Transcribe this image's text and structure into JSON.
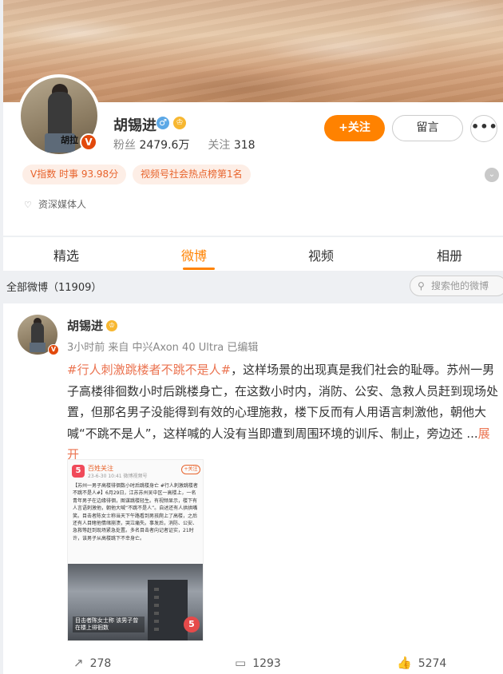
{
  "profile": {
    "name": "胡锡进",
    "avatar_text": "胡拉",
    "verified_badge": "V",
    "gender_icon": "♂",
    "crown_icon": "♔",
    "fans_label": "粉丝",
    "fans_value": "2479.6万",
    "follow_label": "关注",
    "follow_value": "318",
    "follow_button": "+关注",
    "message_button": "留言",
    "more_button": "•••",
    "pill_vindex": "V指数 时事 93.98分",
    "pill_rank": "视频号社会热点榜第1名",
    "expand_icon": "⌄",
    "tagline_icon": "♡",
    "tagline": "资深媒体人"
  },
  "tabs": [
    {
      "label": "精选"
    },
    {
      "label": "微博"
    },
    {
      "label": "视频"
    },
    {
      "label": "相册"
    }
  ],
  "feed": {
    "count_text": "全部微博（11909）",
    "search_icon": "⚲",
    "search_placeholder": "搜索他的微博"
  },
  "post": {
    "author": "胡锡进",
    "crown_icon": "♔",
    "badge": "V",
    "meta": "3小时前  来自 中兴Axon 40 Ultra 已编辑",
    "topic": "#行人刺激跳楼者不跳不是人#",
    "text": "，这样场景的出现真是我们社会的耻辱。苏州一男子高楼徘徊数小时后跳楼身亡，在这数小时内，消防、公安、急救人员赶到现场处置，但那名男子没能得到有效的心理施救，楼下反而有人用语言刺激他，朝他大喊“不跳不是人”，这样喊的人没有当即遭到周围环境的训斥、制止，旁边还 ...",
    "expand": "展开",
    "image": {
      "logo": "5",
      "account": "百姓关注",
      "sub": "23-6-30 10:41 微博视频号",
      "follow": "+关注",
      "text": "【苏州一男子高楼徘徊数小时后跳楼身亡 #行人刺激跳楼者不跳不是人#】6月29日，江苏苏州吴中区一高楼上，一名青年男子在边缘徘徊，图谋跳楼轻生。有视频显示，楼下有人言语刺激他，朝他大喊“不跳不是人”。自述还有人拱拱嘴笑。目击者陈女士称当天下午路看到男孩爬上了高楼，之后还有人目睹他情绪崩溃，哭泣痛失。事发后，消防、公安、急救等赶到现场紧急处置。多名目击者向记者证实，21时许，该男子从高楼跳下不幸身亡。",
      "caption": "目击者陈女士称 该男子曾在楼上徘徊数",
      "watermark": "5"
    },
    "repost_icon": "↗",
    "repost_count": "278",
    "comment_icon": "▭",
    "comment_count": "1293",
    "like_icon": "👍",
    "like_count": "5274"
  }
}
